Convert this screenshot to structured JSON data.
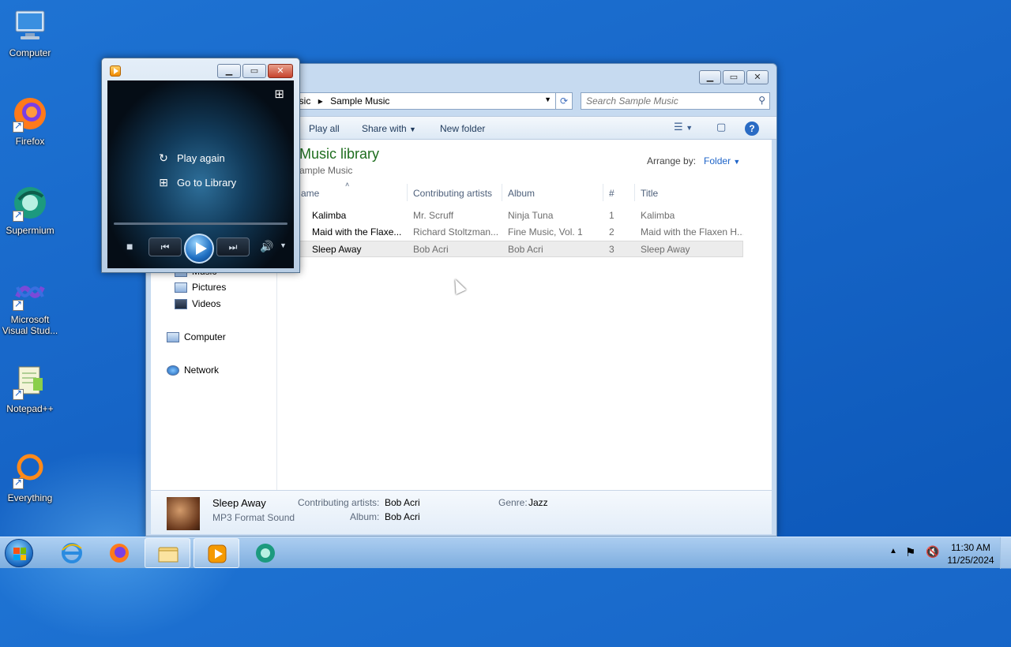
{
  "desktop": {
    "icons": [
      {
        "label": "Computer"
      },
      {
        "label": "Firefox"
      },
      {
        "label": "Supermium"
      },
      {
        "label": "Microsoft Visual Stud..."
      },
      {
        "label": "Notepad++"
      },
      {
        "label": "Everything"
      }
    ]
  },
  "explorer": {
    "breadcrumb": [
      "usic",
      "Sample Music"
    ],
    "search_placeholder": "Search Sample Music",
    "toolbar": {
      "play_all": "Play all",
      "share_with": "Share with",
      "new_folder": "New folder"
    },
    "library_title": "Music library",
    "library_sub": "ample Music",
    "arrange_label": "Arrange by:",
    "arrange_value": "Folder",
    "columns": {
      "name": "ame",
      "artists": "Contributing artists",
      "album": "Album",
      "num": "#",
      "title": "Title"
    },
    "rows": [
      {
        "name": "Kalimba",
        "artist": "Mr. Scruff",
        "album": "Ninja Tuna",
        "num": "1",
        "title": "Kalimba"
      },
      {
        "name": "Maid with the Flaxe...",
        "artist": "Richard Stoltzman...",
        "album": "Fine Music, Vol. 1",
        "num": "2",
        "title": "Maid with the Flaxen H..."
      },
      {
        "name": "Sleep Away",
        "artist": "Bob Acri",
        "album": "Bob Acri",
        "num": "3",
        "title": "Sleep Away"
      }
    ],
    "nav": {
      "music_partial": "Music",
      "pictures": "Pictures",
      "videos": "Videos",
      "computer": "Computer",
      "network": "Network"
    },
    "details": {
      "title": "Sleep Away",
      "type": "MP3 Format Sound",
      "artists_label": "Contributing artists:",
      "artists_value": "Bob Acri",
      "album_label": "Album:",
      "album_value": "Bob Acri",
      "genre_label": "Genre:",
      "genre_value": "Jazz"
    }
  },
  "player": {
    "play_again": "Play again",
    "go_to_library": "Go to Library"
  },
  "taskbar": {
    "time": "11:30 AM",
    "date": "11/25/2024"
  },
  "colors": {
    "desktop_blue": "#1766c8",
    "library_green": "#1e6d1e",
    "link_blue": "#1e64c8"
  }
}
